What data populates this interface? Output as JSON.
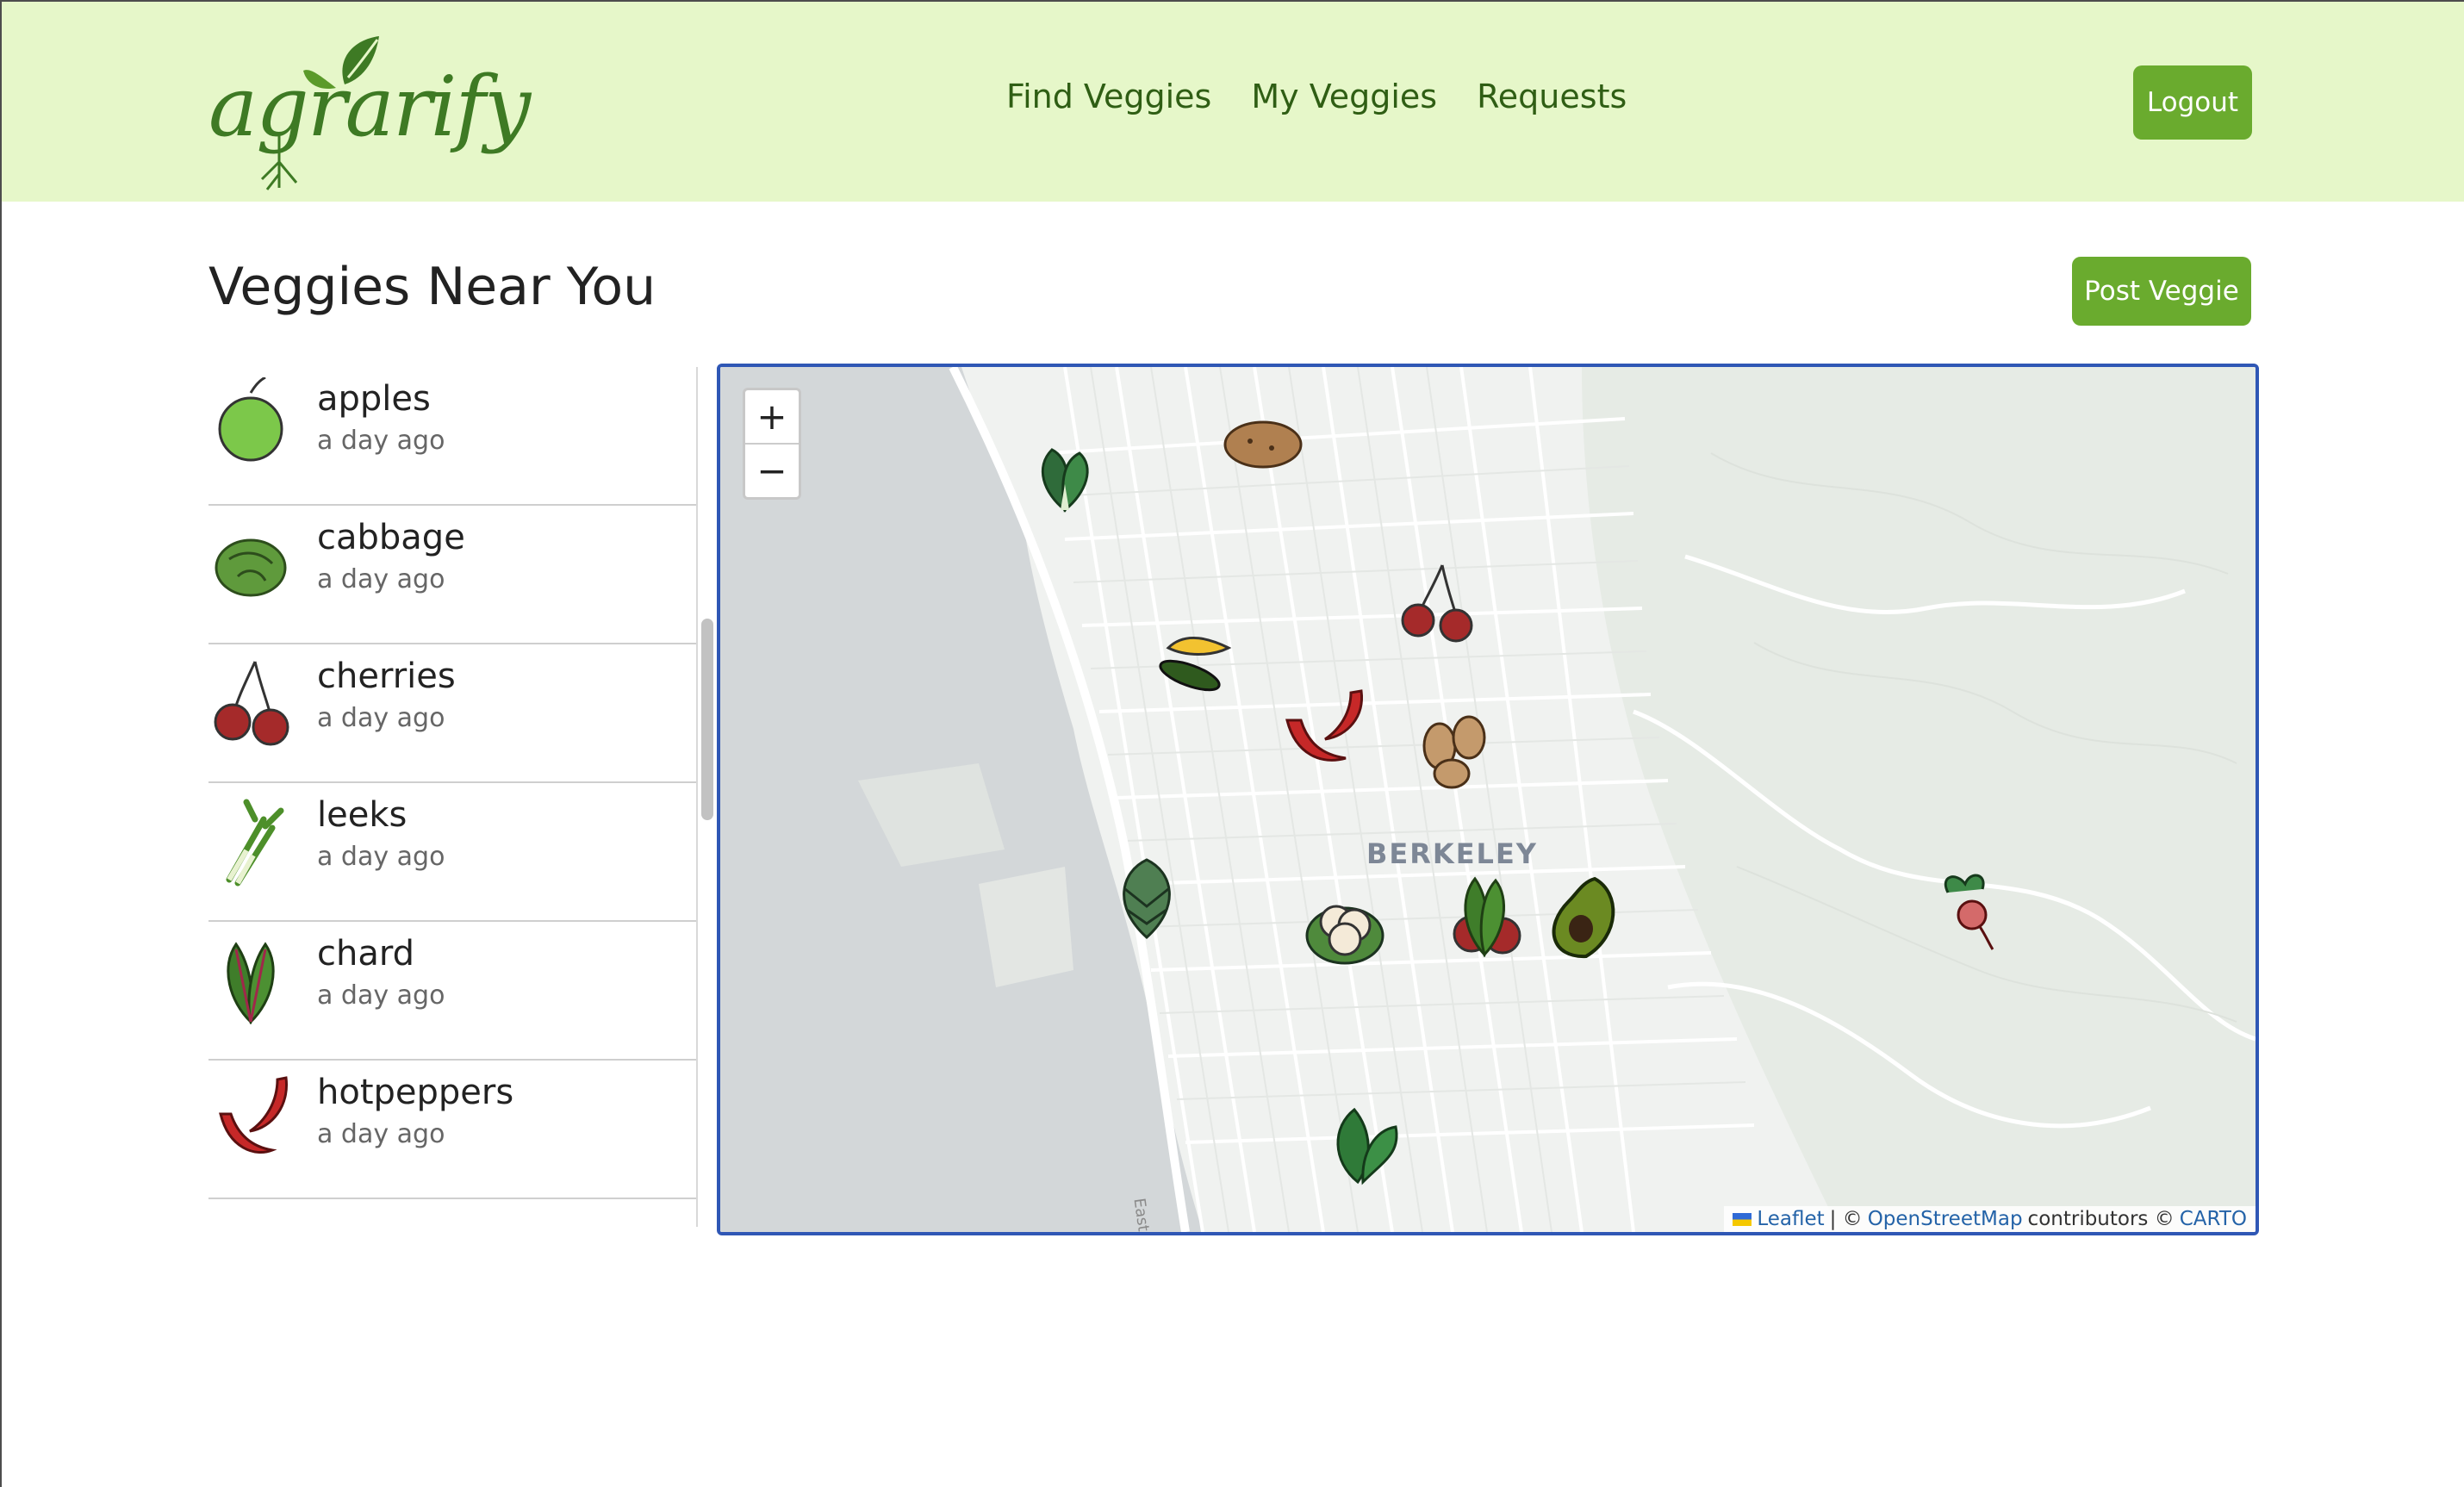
{
  "header": {
    "logo_text": "agrarify",
    "nav": [
      "Find Veggies",
      "My Veggies",
      "Requests"
    ],
    "logout_label": "Logout"
  },
  "page": {
    "title": "Veggies Near You",
    "post_button": "Post Veggie"
  },
  "list": [
    {
      "name": "apples",
      "time": "a day ago",
      "icon": "apple-icon"
    },
    {
      "name": "cabbage",
      "time": "a day ago",
      "icon": "cabbage-icon"
    },
    {
      "name": "cherries",
      "time": "a day ago",
      "icon": "cherries-icon"
    },
    {
      "name": "leeks",
      "time": "a day ago",
      "icon": "leeks-icon"
    },
    {
      "name": "chard",
      "time": "a day ago",
      "icon": "chard-icon"
    },
    {
      "name": "hotpeppers",
      "time": "a day ago",
      "icon": "hotpeppers-icon"
    }
  ],
  "map": {
    "zoom_in": "+",
    "zoom_out": "−",
    "city_label": "BERKELEY",
    "road_label": "Eastshore Fwy",
    "attribution": {
      "leaflet": "Leaflet",
      "sep": "| ©",
      "osm": "OpenStreetMap",
      "contributors": "contributors ©",
      "carto": "CARTO"
    },
    "markers": [
      "bok-choy",
      "potato",
      "cherries",
      "squash",
      "hot-peppers",
      "beans",
      "artichoke",
      "cauliflower",
      "chard",
      "avocado",
      "beet",
      "spinach"
    ]
  },
  "colors": {
    "header_bg": "#e6f7c9",
    "brand_green": "#6aab2e",
    "nav_text": "#2f5e14",
    "map_border": "#2f57b5"
  }
}
